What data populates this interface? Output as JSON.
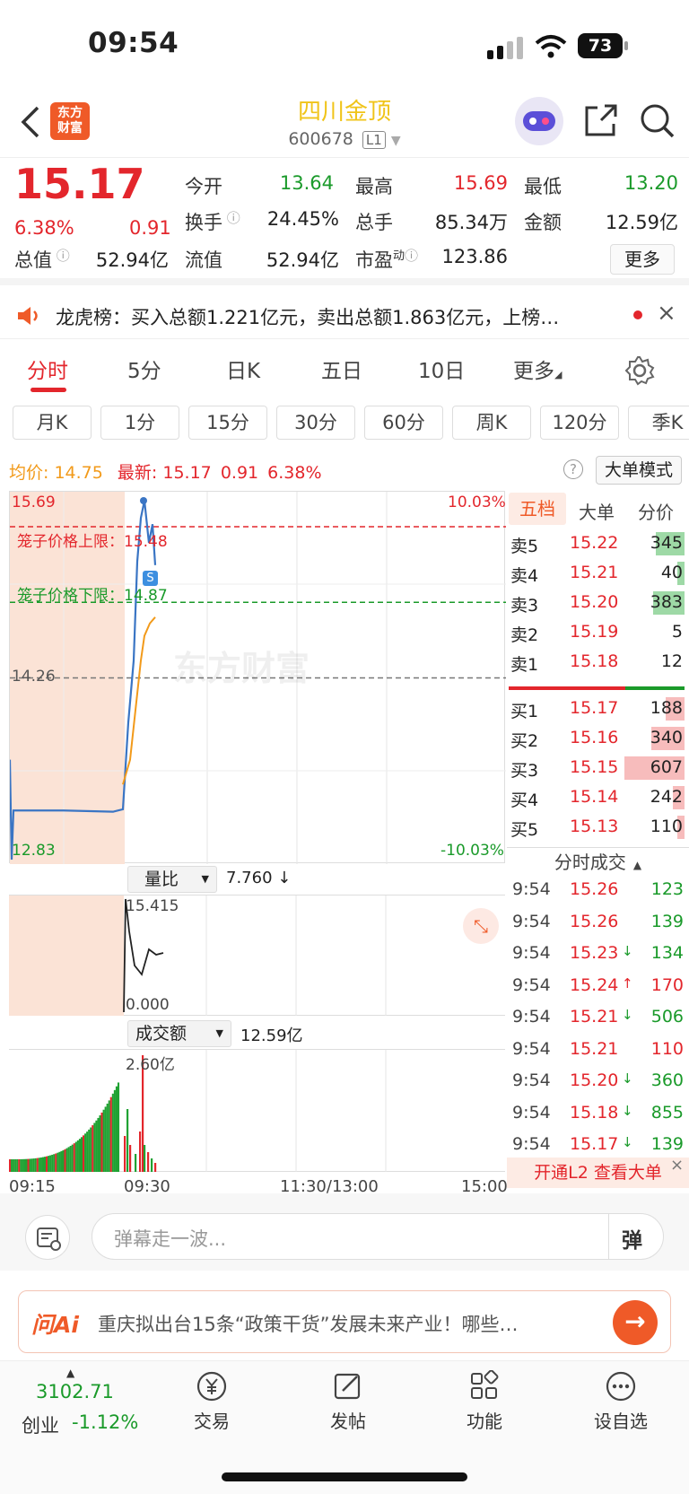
{
  "status": {
    "time": "09:54",
    "battery": "73"
  },
  "header": {
    "logo_text": "东方财富",
    "name": "四川金顶",
    "code": "600678",
    "level_badge": "L1"
  },
  "quote": {
    "price": "15.17",
    "change_pct": "6.38%",
    "change": "0.91",
    "fields": [
      {
        "label": "今开",
        "value": "13.64",
        "color": "#1a9a2a"
      },
      {
        "label": "最高",
        "value": "15.69",
        "color": "#e3262c"
      },
      {
        "label": "最低",
        "value": "13.20",
        "color": "#1a9a2a"
      },
      {
        "label": "换手",
        "value": "24.45%",
        "color": "#222"
      },
      {
        "label": "总手",
        "value": "85.34万",
        "color": "#222"
      },
      {
        "label": "金额",
        "value": "12.59亿",
        "color": "#222"
      },
      {
        "label": "总值",
        "value": "52.94亿",
        "color": "#222"
      },
      {
        "label": "流值",
        "value": "52.94亿",
        "color": "#222"
      },
      {
        "label": "市盈",
        "value": "123.86",
        "color": "#222"
      }
    ],
    "pe_sup": "动",
    "more_label": "更多"
  },
  "notice": {
    "text": "龙虎榜：买入总额1.221亿元，卖出总额1.863亿元，上榜…"
  },
  "tabs": [
    "分时",
    "5分",
    "日K",
    "五日",
    "10日",
    "更多"
  ],
  "subtabs": [
    "月K",
    "1分",
    "15分",
    "30分",
    "60分",
    "周K",
    "120分",
    "季K"
  ],
  "legend": {
    "avg_label": "均价:",
    "avg_value": "14.75",
    "latest_label": "最新:",
    "latest_value": "15.17",
    "change": "0.91",
    "change_pct": "6.38%",
    "big_order_mode": "大单模式"
  },
  "chart": {
    "y_top": "15.69",
    "y_bottom": "12.83",
    "y_mid": "14.26",
    "pct_top": "10.03%",
    "pct_bottom": "-10.03%",
    "upper_label": "笼子价格上限：15.48",
    "lower_label": "笼子价格下限：14.87",
    "watermark": "东方财富",
    "s_badge": "S",
    "ratio_label": "量比",
    "ratio_value": "7.760 ↓",
    "ratio_top": "15.415",
    "ratio_bottom": "0.000",
    "amount_label": "成交额",
    "amount_value": "12.59亿",
    "amount_top": "2.60亿",
    "x_labels": [
      "09:15",
      "09:30",
      "11:30/13:00",
      "15:00"
    ]
  },
  "chart_data": {
    "type": "line",
    "title": "",
    "price_range": [
      12.83,
      15.69
    ],
    "prev_close": 14.26,
    "upper_limit": 15.48,
    "lower_limit": 14.87,
    "series": [
      {
        "name": "",
        "values": [
          13.19,
          13.19,
          13.19,
          13.18,
          13.2,
          13.9,
          14.4,
          15.2,
          15.55,
          15.69,
          15.35,
          15.5,
          15.17
        ]
      },
      {
        "name": "",
        "values": [
          13.4,
          13.6,
          14.0,
          14.4,
          14.6,
          14.7,
          14.75
        ]
      }
    ]
  },
  "orderbook": {
    "tabs": [
      "五档",
      "大单",
      "分价"
    ],
    "sells": [
      {
        "label": "卖5",
        "price": "15.22",
        "vol": "345",
        "bar": 0.2
      },
      {
        "label": "卖4",
        "price": "15.21",
        "vol": "40",
        "bar": 0.05
      },
      {
        "label": "卖3",
        "price": "15.20",
        "vol": "383",
        "bar": 0.22
      },
      {
        "label": "卖2",
        "price": "15.19",
        "vol": "5",
        "bar": 0.0
      },
      {
        "label": "卖1",
        "price": "15.18",
        "vol": "12",
        "bar": 0.0
      }
    ],
    "buys": [
      {
        "label": "买1",
        "price": "15.17",
        "vol": "188",
        "bar": 0.13
      },
      {
        "label": "买2",
        "price": "15.16",
        "vol": "340",
        "bar": 0.23
      },
      {
        "label": "买3",
        "price": "15.15",
        "vol": "607",
        "bar": 0.42
      },
      {
        "label": "买4",
        "price": "15.14",
        "vol": "242",
        "bar": 0.08
      },
      {
        "label": "买5",
        "price": "15.13",
        "vol": "110",
        "bar": 0.05
      }
    ],
    "ticks_title": "分时成交",
    "ticks": [
      {
        "time": "9:54",
        "price": "15.26",
        "vol": "123",
        "arrow": "",
        "vcolor": "#1a9a2a"
      },
      {
        "time": "9:54",
        "price": "15.26",
        "vol": "139",
        "arrow": "",
        "vcolor": "#1a9a2a"
      },
      {
        "time": "9:54",
        "price": "15.23",
        "vol": "134",
        "arrow": "↓",
        "vcolor": "#1a9a2a"
      },
      {
        "time": "9:54",
        "price": "15.24",
        "vol": "170",
        "arrow": "↑",
        "vcolor": "#e3262c"
      },
      {
        "time": "9:54",
        "price": "15.21",
        "vol": "506",
        "arrow": "↓",
        "vcolor": "#1a9a2a"
      },
      {
        "time": "9:54",
        "price": "15.21",
        "vol": "110",
        "arrow": "",
        "vcolor": "#e3262c"
      },
      {
        "time": "9:54",
        "price": "15.20",
        "vol": "360",
        "arrow": "↓",
        "vcolor": "#1a9a2a"
      },
      {
        "time": "9:54",
        "price": "15.18",
        "vol": "855",
        "arrow": "↓",
        "vcolor": "#1a9a2a"
      },
      {
        "time": "9:54",
        "price": "15.17",
        "vol": "139",
        "arrow": "↓",
        "vcolor": "#1a9a2a"
      }
    ],
    "l2_label": "开通L2 查看大单"
  },
  "danmu": {
    "placeholder": "弹幕走一波...",
    "btn": "弹"
  },
  "ai": {
    "brand": "问Ai",
    "text": "重庆拟出台15条“政策干货”发展未来产业！哪些…"
  },
  "bottom_nav": {
    "index_value": "3102.71",
    "index_name": "创业",
    "index_change": "-1.12%",
    "items": [
      {
        "label": "交易",
        "icon": "yen-icon"
      },
      {
        "label": "发帖",
        "icon": "edit-icon"
      },
      {
        "label": "功能",
        "icon": "grid-icon"
      },
      {
        "label": "设自选",
        "icon": "dots-icon"
      }
    ]
  }
}
